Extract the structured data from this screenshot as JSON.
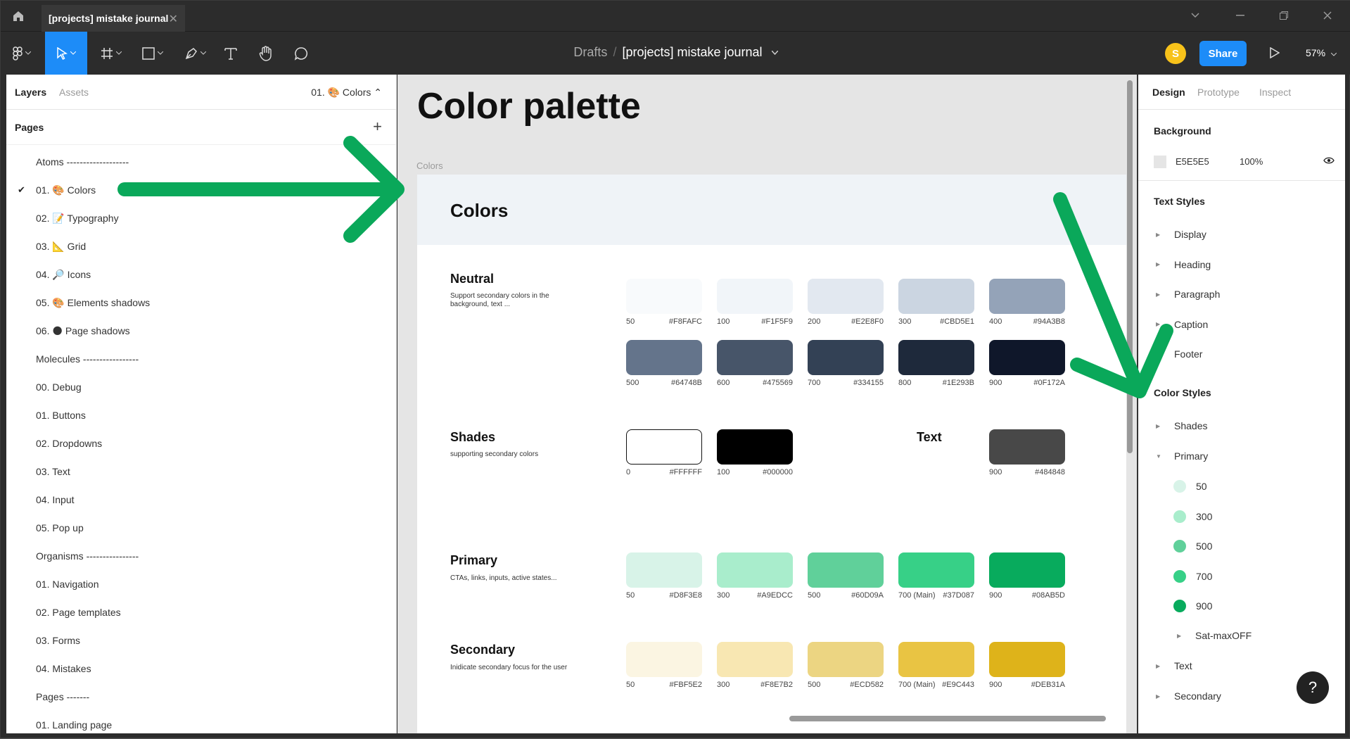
{
  "titlebar": {
    "tab_title": "[projects] mistake journal",
    "close": "✕"
  },
  "toolbar": {
    "breadcrumb_parent": "Drafts",
    "breadcrumb_sep": "/",
    "file_name": "[projects] mistake journal",
    "avatar_initial": "S",
    "share_label": "Share",
    "zoom": "57%"
  },
  "left": {
    "tab_layers": "Layers",
    "tab_assets": "Assets",
    "current_page": "01. 🎨 Colors ⌃",
    "pages_title": "Pages",
    "add": "+",
    "pages": [
      {
        "label": "Atoms -------------------"
      },
      {
        "label": "01. 🎨 Colors",
        "checked": true
      },
      {
        "label": "02. 📝 Typography"
      },
      {
        "label": "03. 📐 Grid"
      },
      {
        "label": "04. 🔎 Icons"
      },
      {
        "label": "05. 🎨 Elements shadows"
      },
      {
        "label": "06. 🌑 Page shadows"
      },
      {
        "label": "Molecules -----------------"
      },
      {
        "label": "00. Debug"
      },
      {
        "label": "01. Buttons"
      },
      {
        "label": "02. Dropdowns"
      },
      {
        "label": "03. Text"
      },
      {
        "label": "04. Input"
      },
      {
        "label": "05. Pop up"
      },
      {
        "label": "Organisms ----------------"
      },
      {
        "label": "01. Navigation"
      },
      {
        "label": "02. Page templates"
      },
      {
        "label": "03. Forms"
      },
      {
        "label": "04. Mistakes"
      },
      {
        "label": "Pages -------"
      },
      {
        "label": "01. Landing page"
      }
    ]
  },
  "canvas": {
    "heading": "Color palette",
    "frame_label": "Colors",
    "frame_title": "Colors",
    "sections": {
      "neutral": {
        "title": "Neutral",
        "desc": "Support secondary colors in the background, text ..."
      },
      "shades": {
        "title": "Shades",
        "desc": "supporting secondary colors"
      },
      "text": {
        "title": "Text"
      },
      "primary": {
        "title": "Primary",
        "desc": "CTAs, links, inputs, active states..."
      },
      "secondary": {
        "title": "Secondary",
        "desc": "Inidicate secondary focus for the user"
      }
    },
    "neutral_row1": [
      {
        "name": "50",
        "hex": "#F8FAFC"
      },
      {
        "name": "100",
        "hex": "#F1F5F9"
      },
      {
        "name": "200",
        "hex": "#E2E8F0"
      },
      {
        "name": "300",
        "hex": "#CBD5E1"
      },
      {
        "name": "400",
        "hex": "#94A3B8"
      }
    ],
    "neutral_row2": [
      {
        "name": "500",
        "hex": "#64748B"
      },
      {
        "name": "600",
        "hex": "#475569"
      },
      {
        "name": "700",
        "hex": "#334155"
      },
      {
        "name": "800",
        "hex": "#1E293B"
      },
      {
        "name": "900",
        "hex": "#0F172A"
      }
    ],
    "shades": [
      {
        "name": "0",
        "hex": "#FFFFFF"
      },
      {
        "name": "100",
        "hex": "#000000"
      }
    ],
    "text_swatch": {
      "name": "900",
      "hex": "#484848"
    },
    "primary": [
      {
        "name": "50",
        "hex": "#D8F3E8"
      },
      {
        "name": "300",
        "hex": "#A9EDCC"
      },
      {
        "name": "500",
        "hex": "#60D09A"
      },
      {
        "name": "700 (Main)",
        "hex": "#37D087"
      },
      {
        "name": "900",
        "hex": "#08AB5D"
      }
    ],
    "secondary": [
      {
        "name": "50",
        "hex": "#FBF5E2"
      },
      {
        "name": "300",
        "hex": "#F8E7B2"
      },
      {
        "name": "500",
        "hex": "#ECD582"
      },
      {
        "name": "700 (Main)",
        "hex": "#E9C443"
      },
      {
        "name": "900",
        "hex": "#DEB31A"
      }
    ]
  },
  "right": {
    "tab_design": "Design",
    "tab_prototype": "Prototype",
    "tab_inspect": "Inspect",
    "background_title": "Background",
    "bg_hex": "E5E5E5",
    "bg_opacity": "100%",
    "bg_color": "#E5E5E5",
    "text_styles_title": "Text Styles",
    "text_styles": [
      "Display",
      "Heading",
      "Paragraph",
      "Caption",
      "Footer"
    ],
    "color_styles_title": "Color Styles",
    "color_groups_top": [
      "Shades",
      "Primary"
    ],
    "primary_styles": [
      {
        "name": "50",
        "color": "#D8F3E8"
      },
      {
        "name": "300",
        "color": "#A9EDCC"
      },
      {
        "name": "500",
        "color": "#60D09A"
      },
      {
        "name": "700",
        "color": "#37D087"
      },
      {
        "name": "900",
        "color": "#08AB5D"
      }
    ],
    "sat_group": "Sat-maxOFF",
    "color_groups_bottom": [
      "Text",
      "Secondary"
    ],
    "help": "?"
  },
  "annotation_color": "#0aa85a"
}
